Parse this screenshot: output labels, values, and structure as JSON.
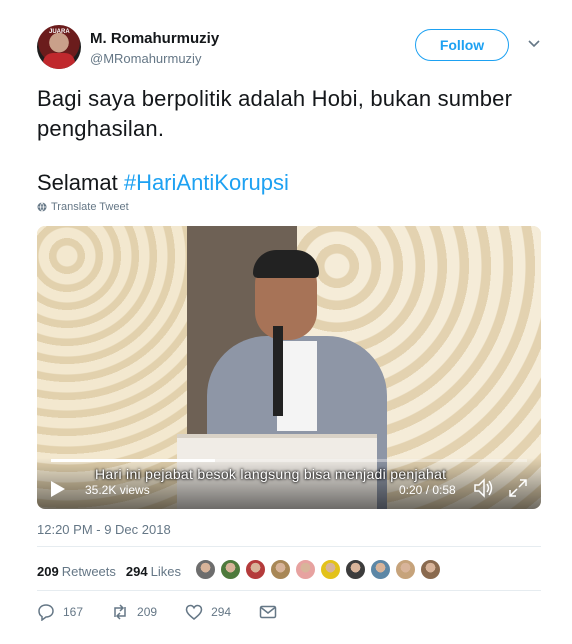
{
  "author": {
    "name": "M. Romahurmuziy",
    "handle": "@MRomahurmuziy",
    "avatar_text": "JUARA"
  },
  "follow_label": "Follow",
  "tweet": {
    "line1": "Bagi saya berpolitik adalah Hobi, bukan sumber penghasilan.",
    "greeting": "Selamat ",
    "hashtag": "#HariAntiKorupsi",
    "translate_label": "Translate Tweet"
  },
  "video": {
    "caption": "Hari ini pejabat besok langsung bisa menjadi penjahat",
    "views": "35.2K views",
    "time": "0:20 / 0:58",
    "progress_fraction": 0.345
  },
  "timestamp": "12:20 PM - 9 Dec 2018",
  "stats": {
    "retweets_count": "209",
    "retweets_label": "Retweets",
    "likes_count": "294",
    "likes_label": "Likes"
  },
  "liker_avatars": [
    "#6d6d6d",
    "#4e7a3c",
    "#b43b3b",
    "#a88756",
    "#e7a2a0",
    "#e3c21a",
    "#3c3c3c",
    "#5c87a6",
    "#c6a37b",
    "#8a6a4e"
  ],
  "actions": {
    "replies": "167",
    "retweets": "209",
    "likes": "294"
  },
  "colors": {
    "accent": "#1da1f2",
    "secondary_text": "#657786"
  }
}
